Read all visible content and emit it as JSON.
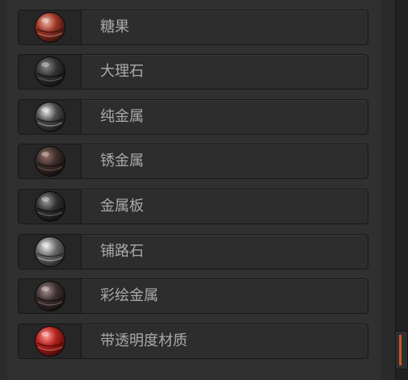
{
  "materials": [
    {
      "label": "糖果",
      "icon": "candy-material-sphere-icon",
      "colors": {
        "base": "#9a3325",
        "light": "#f0b5a8",
        "dark": "#2a0c08"
      }
    },
    {
      "label": "大理石",
      "icon": "marble-material-sphere-icon",
      "colors": {
        "base": "#333333",
        "light": "#8a8a8a",
        "dark": "#0d0d0d"
      }
    },
    {
      "label": "纯金属",
      "icon": "pure-metal-material-sphere-icon",
      "colors": {
        "base": "#4a4a4a",
        "light": "#e6e6e6",
        "dark": "#111111"
      }
    },
    {
      "label": "锈金属",
      "icon": "rust-metal-material-sphere-icon",
      "colors": {
        "base": "#3a2e2c",
        "light": "#9a7068",
        "dark": "#120b0a"
      }
    },
    {
      "label": "金属板",
      "icon": "metal-plate-material-sphere-icon",
      "colors": {
        "base": "#303030",
        "light": "#9d9d9d",
        "dark": "#0c0c0c"
      }
    },
    {
      "label": "铺路石",
      "icon": "paving-stone-material-sphere-icon",
      "colors": {
        "base": "#6a6a6a",
        "light": "#efefef",
        "dark": "#1f1f1f"
      }
    },
    {
      "label": "彩绘金属",
      "icon": "painted-metal-material-sphere-icon",
      "colors": {
        "base": "#3d3030",
        "light": "#a89090",
        "dark": "#120c0c"
      }
    },
    {
      "label": "带透明度材质",
      "icon": "transparent-material-sphere-icon",
      "colors": {
        "base": "#b3211c",
        "light": "#ff9e97",
        "dark": "#3d0705"
      }
    }
  ],
  "theme": {
    "background": "#2b2b2b",
    "panel": "#303030",
    "text": "#a9a9a9",
    "side_accent": "#c9541e"
  }
}
